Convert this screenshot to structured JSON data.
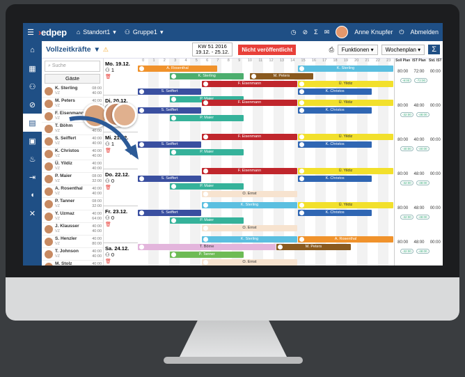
{
  "topbar": {
    "logo": "edpep",
    "standort": "Standort1",
    "gruppe": "Gruppe1",
    "user": "Anne Knupfer",
    "logout": "Abmelden"
  },
  "toolbar": {
    "title": "Vollzeitkräfte",
    "kw_line1": "KW 51 2016",
    "kw_line2": "19.12. - 25.12.",
    "not_published": "Nicht veröffentlicht",
    "funktionen": "Funktionen",
    "wochenplan": "Wochenplan",
    "sigma": "Σ"
  },
  "sidebar": {
    "search_placeholder": "Suche",
    "guests": "Gäste",
    "employees": [
      {
        "name": "K. Sterling",
        "role": "VZ",
        "h1": "08:00",
        "h2": "40:00"
      },
      {
        "name": "M. Peters",
        "role": "VZ",
        "h1": "40:00",
        "h2": "40:00"
      },
      {
        "name": "F. Eisenmann",
        "role": "VZ",
        "h1": "40:00",
        "h2": "40:00"
      },
      {
        "name": "T. Böhm",
        "role": "VZ",
        "h1": "40:00",
        "h2": "40:00"
      },
      {
        "name": "S. Seiffert",
        "role": "VZ",
        "h1": "40:00",
        "h2": "40:00"
      },
      {
        "name": "K. Christos",
        "role": "VZ",
        "h1": "40:00",
        "h2": "40:00"
      },
      {
        "name": "Ü. Yildiz",
        "role": "VZ",
        "h1": "40:00",
        "h2": "40:00"
      },
      {
        "name": "P. Maier",
        "role": "VZ",
        "h1": "08:00",
        "h2": "32:00"
      },
      {
        "name": "A. Rosenthal",
        "role": "VZ",
        "h1": "40:00",
        "h2": "40:00"
      },
      {
        "name": "P. Tanner",
        "role": "VZ",
        "h1": "08:00",
        "h2": "32:00"
      },
      {
        "name": "Y. Uzmaz",
        "role": "VZ",
        "h1": "40:00",
        "h2": "64:00"
      },
      {
        "name": "J. Klausser",
        "role": "VZ",
        "h1": "40:00",
        "h2": "40:00"
      },
      {
        "name": "S. Henzler",
        "role": "VZ",
        "h1": "40:00",
        "h2": "80:00"
      },
      {
        "name": "T. Johnson",
        "role": "VZ",
        "h1": "40:00",
        "h2": "40:00"
      },
      {
        "name": "M. Stolz",
        "role": "VZ",
        "h1": "40:00",
        "h2": "40:00"
      }
    ]
  },
  "hours": [
    "0",
    "1",
    "2",
    "3",
    "4",
    "5",
    "6",
    "7",
    "8",
    "9",
    "10",
    "11",
    "12",
    "13",
    "14",
    "15",
    "16",
    "17",
    "18",
    "19",
    "20",
    "21",
    "22",
    "23"
  ],
  "days": [
    {
      "label": "Mo. 19.12.",
      "count": "1"
    },
    {
      "label": "Di. 20.12.",
      "count": "0"
    },
    {
      "label": "Mi. 21.12.",
      "count": "1"
    },
    {
      "label": "Do. 22.12.",
      "count": "0"
    },
    {
      "label": "Fr. 23.12.",
      "count": "0"
    },
    {
      "label": "Sa. 24.12.",
      "count": "0"
    }
  ],
  "shifts": [
    {
      "name": "A. Rosenthal",
      "color": "#f0922b"
    },
    {
      "name": "K. Sterling",
      "color": "#5bbfe0"
    },
    {
      "name": "K. Sterling",
      "color": "#4cae6e"
    },
    {
      "name": "M. Peters",
      "color": "#8a5a1f"
    },
    {
      "name": "F. Eisenmann",
      "color": "#c0262c"
    },
    {
      "name": "Ü. Yildiz",
      "color": "#f2e02c"
    },
    {
      "name": "S. Seiffert",
      "color": "#3a4fa0"
    },
    {
      "name": "K. Christos",
      "color": "#2f66b3"
    },
    {
      "name": "P. Maier",
      "color": "#35b29a"
    },
    {
      "name": "O. Ernst",
      "color": "#f7e3cf"
    },
    {
      "name": "T. Börne",
      "color": "#e3b5dc"
    },
    {
      "name": "P. Tanner",
      "color": "#6dbb55"
    }
  ],
  "stats": {
    "headers": [
      "Soll Plan",
      "IST Plan",
      "Std. IST"
    ],
    "rows": [
      [
        "80:00",
        "72:00",
        "00:00"
      ],
      [
        "80:00",
        "48:00",
        "00:00"
      ],
      [
        "80:00",
        "40:00",
        "00:00"
      ],
      [
        "80:00",
        "48:00",
        "00:00"
      ],
      [
        "80:00",
        "48:00",
        "00:00"
      ],
      [
        "80:00",
        "48:00",
        "00:00"
      ]
    ],
    "pills": [
      [
        "-8:00",
        "-72:00"
      ],
      [
        "-32:00",
        "-48:00"
      ],
      [
        "-40:00",
        "-40:00"
      ],
      [
        "-32:00",
        "-48:00"
      ],
      [
        "-32:00",
        "-48:00"
      ],
      [
        "-32:00",
        "-48:00"
      ]
    ]
  }
}
